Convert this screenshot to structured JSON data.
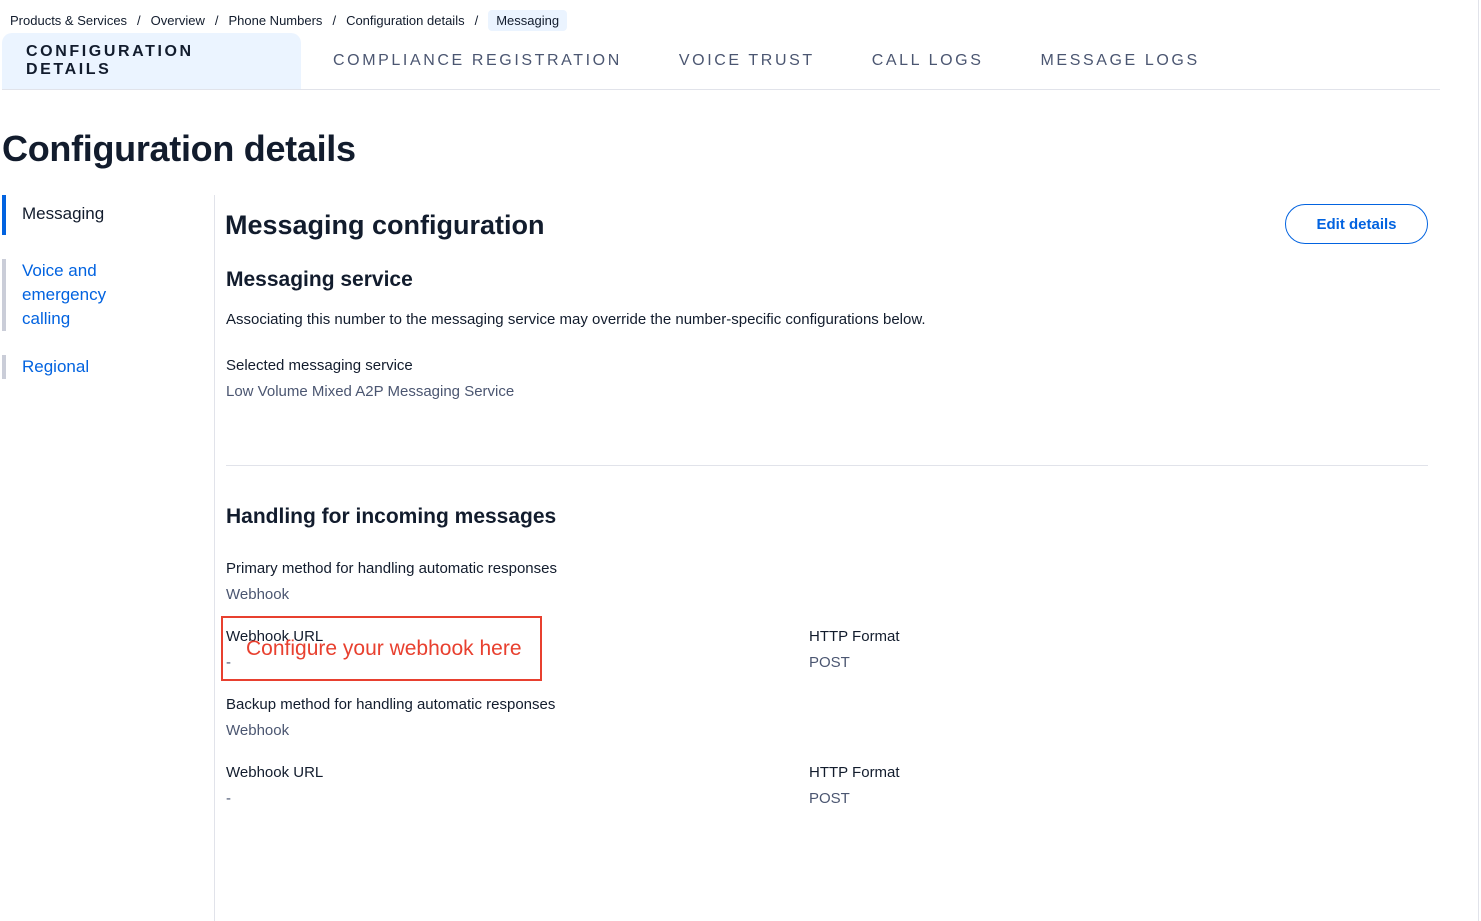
{
  "breadcrumb": {
    "items": [
      "Products & Services",
      "Overview",
      "Phone Numbers",
      "Configuration details"
    ],
    "separator": "/",
    "current": "Messaging"
  },
  "tabs": [
    {
      "label": "CONFIGURATION DETAILS",
      "active": true
    },
    {
      "label": "COMPLIANCE REGISTRATION",
      "active": false
    },
    {
      "label": "VOICE TRUST",
      "active": false
    },
    {
      "label": "CALL LOGS",
      "active": false
    },
    {
      "label": "MESSAGE LOGS",
      "active": false
    }
  ],
  "page_title": "Configuration details",
  "sidenav": {
    "items": [
      {
        "label": "Messaging",
        "active": true
      },
      {
        "label": "Voice and emergency calling",
        "active": false
      },
      {
        "label": "Regional",
        "active": false
      }
    ]
  },
  "main": {
    "title": "Messaging configuration",
    "edit_button": "Edit details",
    "messaging_service": {
      "heading": "Messaging service",
      "description": "Associating this number to the messaging service may override the number-specific configurations below.",
      "selected_label": "Selected messaging service",
      "selected_value": "Low Volume Mixed A2P Messaging Service"
    },
    "incoming": {
      "heading": "Handling for incoming messages",
      "primary_label": "Primary method for handling automatic responses",
      "primary_value": "Webhook",
      "primary_webhook_label": "Webhook URL",
      "primary_webhook_value": "-",
      "primary_http_label": "HTTP Format",
      "primary_http_value": "POST",
      "backup_label": "Backup method for handling automatic responses",
      "backup_value": "Webhook",
      "backup_webhook_label": "Webhook URL",
      "backup_webhook_value": "-",
      "backup_http_label": "HTTP Format",
      "backup_http_value": "POST"
    }
  },
  "annotation": {
    "text": "Configure your webhook here",
    "color": "#e8402f"
  },
  "colors": {
    "accent": "#0263e0",
    "text": "#121c2d",
    "muted": "#4b5671",
    "active_tab_bg": "#ebf4ff"
  }
}
